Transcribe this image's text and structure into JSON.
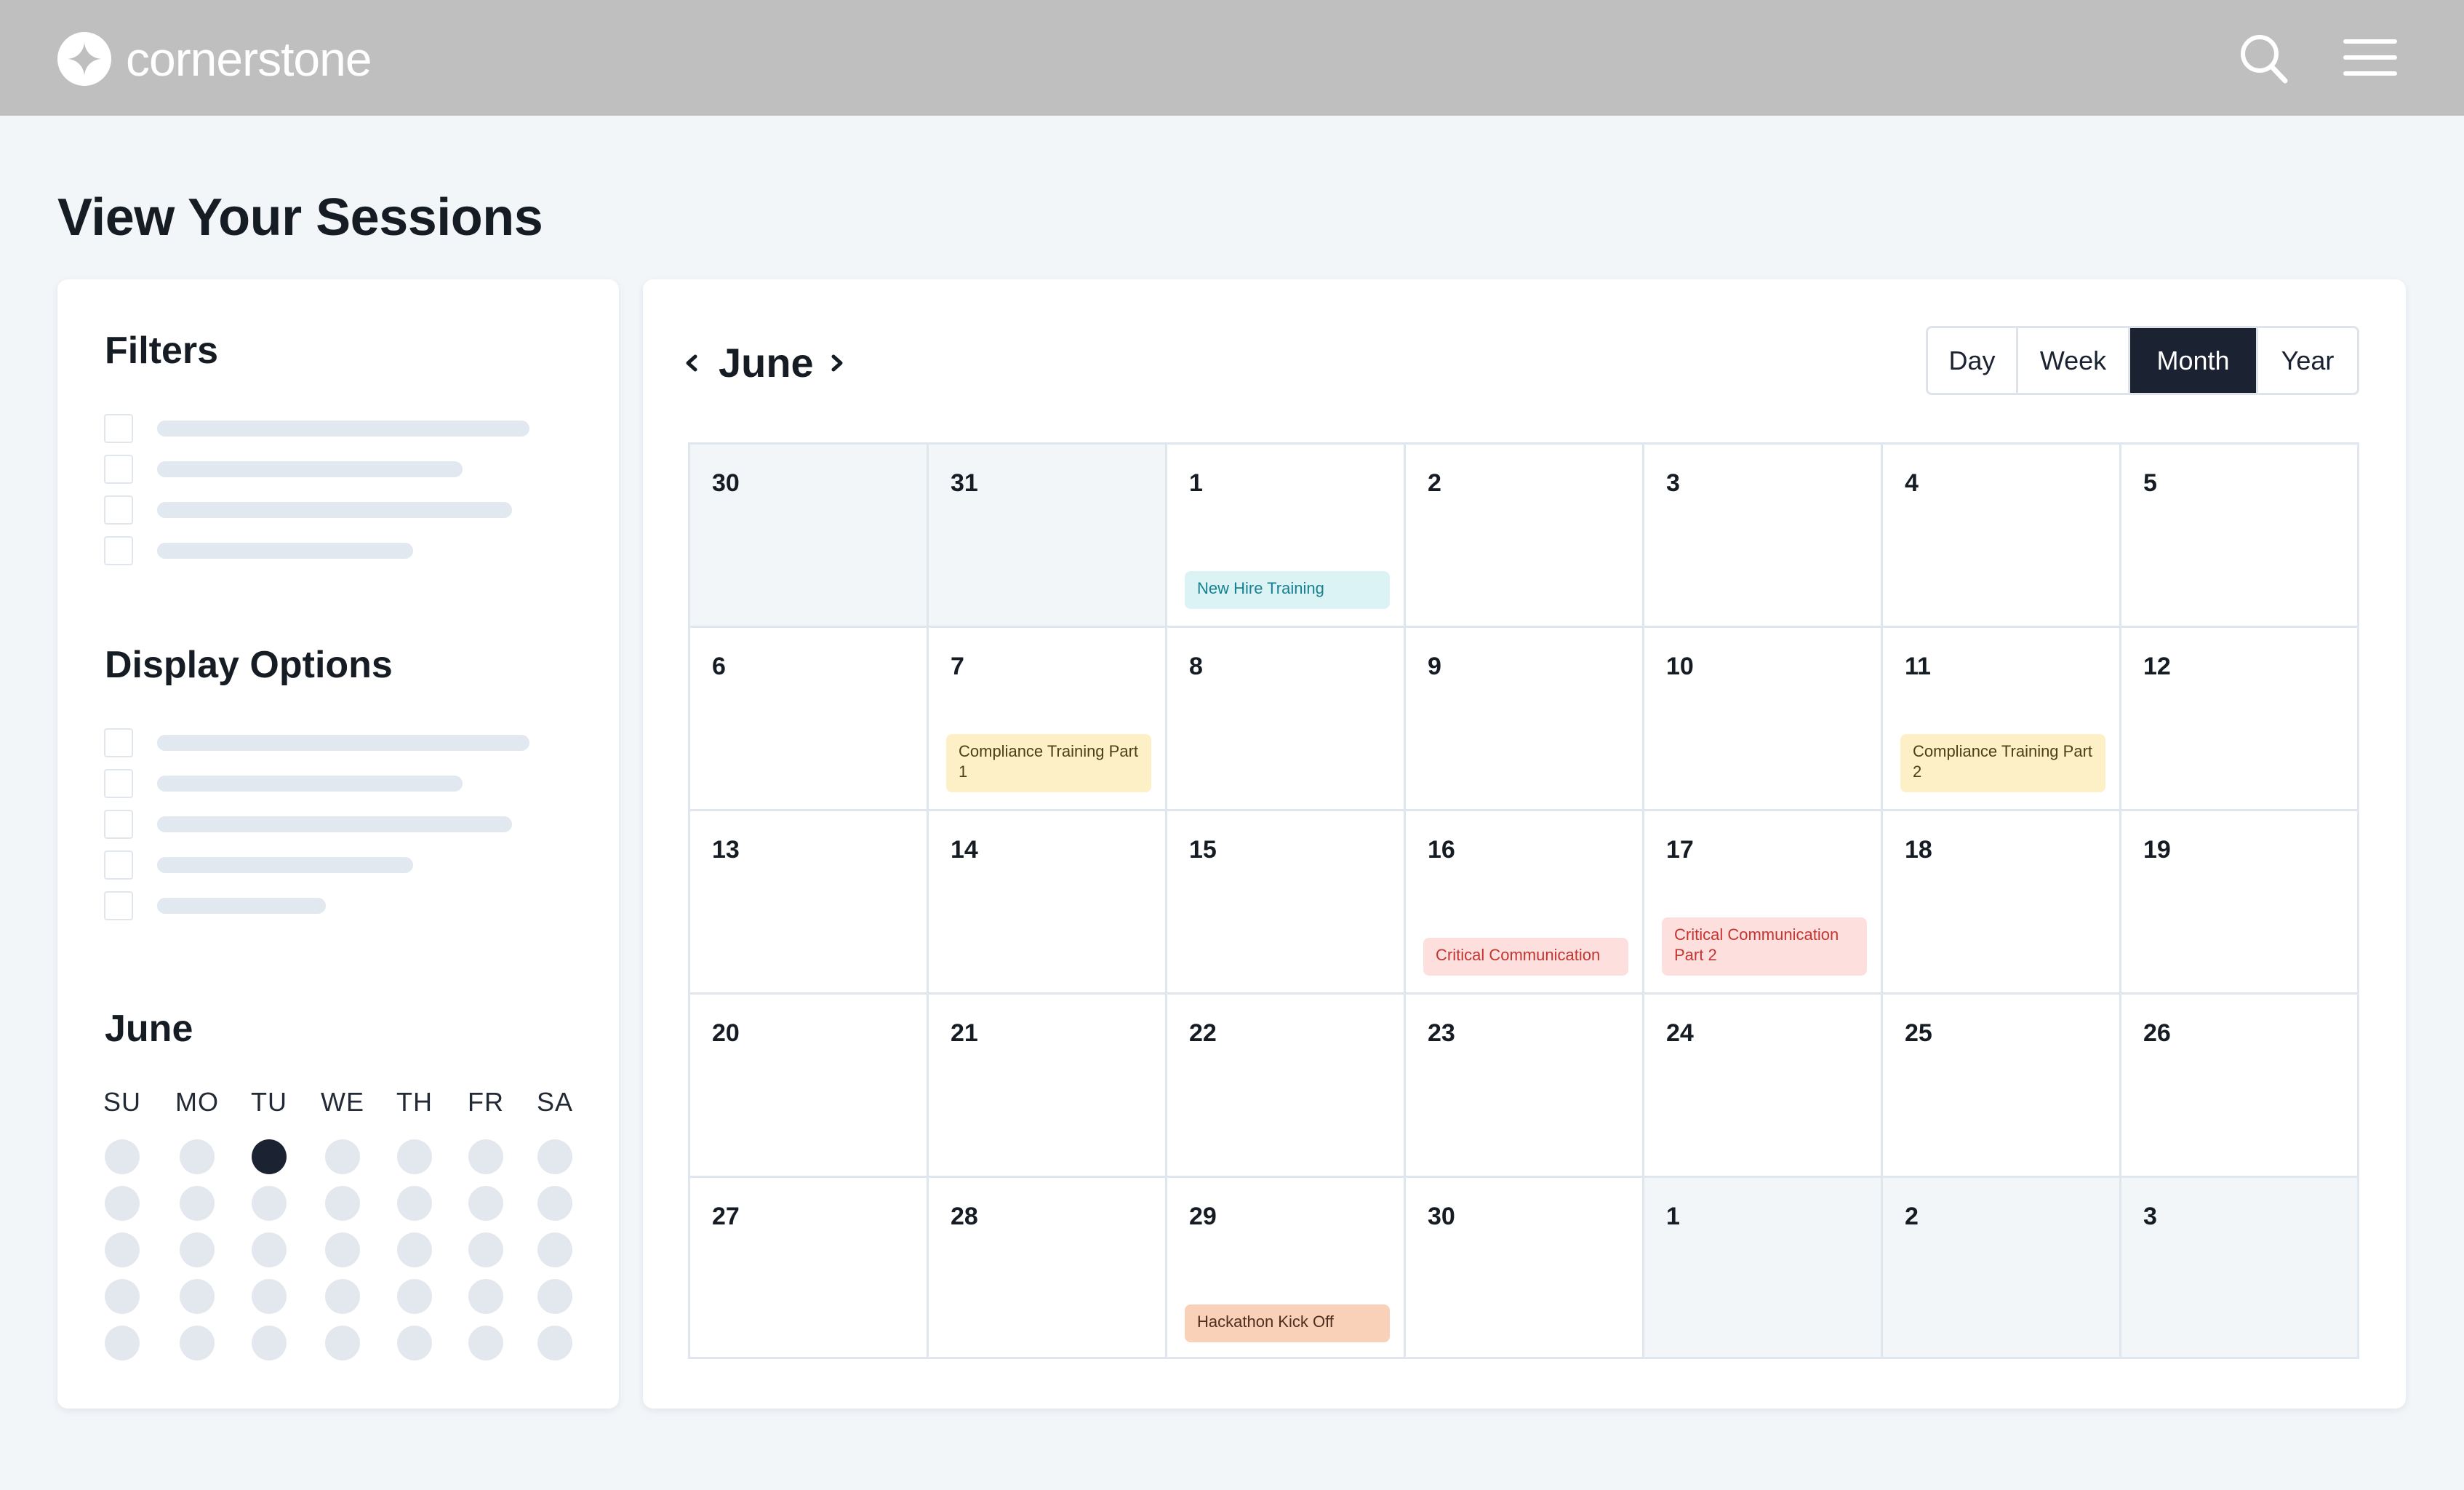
{
  "header": {
    "brand": "cornerstone",
    "icons": [
      "logo-mark-icon",
      "search-icon",
      "hamburger-menu-icon"
    ]
  },
  "page": {
    "title": "View Your Sessions"
  },
  "sidebar": {
    "filters_title": "Filters",
    "display_options_title": "Display Options",
    "mini_calendar": {
      "title": "June",
      "weekdays": [
        "SU",
        "MO",
        "TU",
        "WE",
        "TH",
        "FR",
        "SA"
      ],
      "rows": 5,
      "selected_row": 0,
      "selected_col": 2
    }
  },
  "calendar": {
    "month": "June",
    "views": [
      "Day",
      "Week",
      "Month",
      "Year"
    ],
    "active_view": "Month",
    "colors": {
      "active_view": "#1b2231",
      "outside_month": "#f2f6f9",
      "event_cyan": "#dcf3f6",
      "event_yellow": "#fdefc6",
      "event_pink": "#fde0de",
      "event_orange": "#f9d1b8"
    },
    "weeks": [
      [
        {
          "day": "30",
          "out": true
        },
        {
          "day": "31",
          "out": true
        },
        {
          "day": "1",
          "event": {
            "label": "New Hire Training",
            "color": "cyan"
          }
        },
        {
          "day": "2"
        },
        {
          "day": "3"
        },
        {
          "day": "4"
        },
        {
          "day": "5"
        }
      ],
      [
        {
          "day": "6"
        },
        {
          "day": "7",
          "event": {
            "label": "Compliance Training Part 1",
            "color": "yellow"
          }
        },
        {
          "day": "8"
        },
        {
          "day": "9"
        },
        {
          "day": "10"
        },
        {
          "day": "11",
          "event": {
            "label": "Compliance Training Part 2",
            "color": "yellow"
          }
        },
        {
          "day": "12"
        }
      ],
      [
        {
          "day": "13"
        },
        {
          "day": "14"
        },
        {
          "day": "15"
        },
        {
          "day": "16",
          "event": {
            "label": "Critical Communication",
            "color": "pink"
          }
        },
        {
          "day": "17",
          "event": {
            "label": "Critical Communication Part 2",
            "color": "pink"
          }
        },
        {
          "day": "18"
        },
        {
          "day": "19"
        }
      ],
      [
        {
          "day": "20"
        },
        {
          "day": "21"
        },
        {
          "day": "22"
        },
        {
          "day": "23"
        },
        {
          "day": "24"
        },
        {
          "day": "25"
        },
        {
          "day": "26"
        }
      ],
      [
        {
          "day": "27"
        },
        {
          "day": "28"
        },
        {
          "day": "29",
          "event": {
            "label": "Hackathon Kick Off",
            "color": "orange"
          }
        },
        {
          "day": "30"
        },
        {
          "day": "1",
          "out": true
        },
        {
          "day": "2",
          "out": true
        },
        {
          "day": "3",
          "out": true
        }
      ]
    ]
  }
}
